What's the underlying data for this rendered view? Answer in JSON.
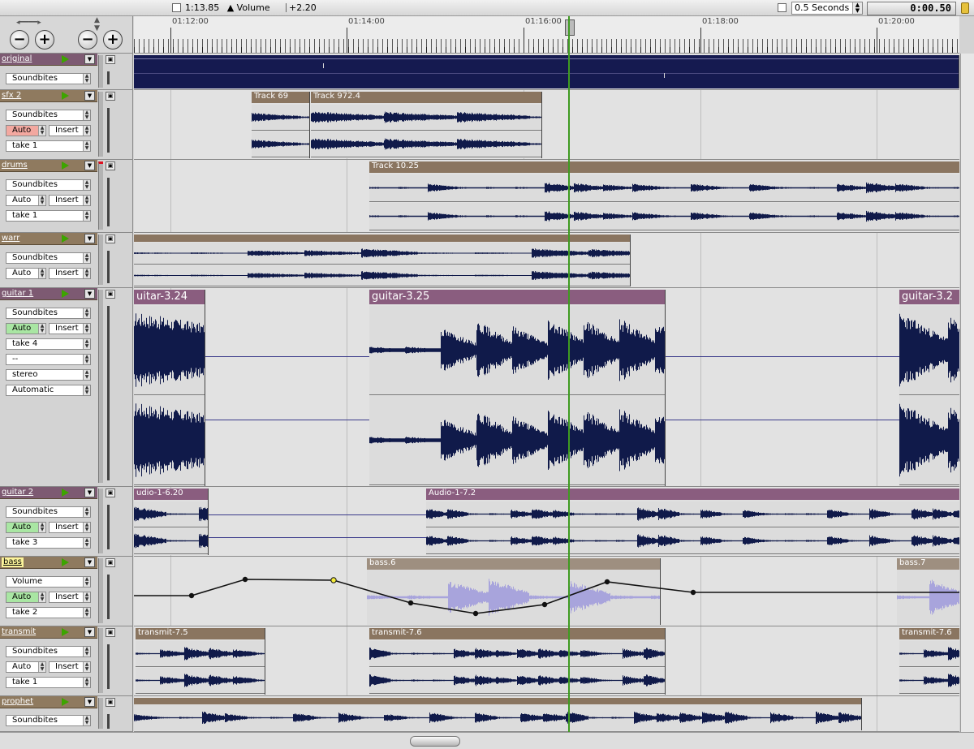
{
  "toolbar": {
    "position": "1:13.85",
    "param_label": "Volume",
    "param_value": "+2.20",
    "resolution": "0.5 Seconds",
    "counter": "0:00.50"
  },
  "ruler": {
    "labels": [
      "01:12:00",
      "01:14:00",
      "01:16:00",
      "01:18:00",
      "01:20:00"
    ]
  },
  "tracks": [
    {
      "name": "original",
      "fields": [
        "Soundbites"
      ]
    },
    {
      "name": "sfx 2",
      "fields": [
        "Soundbites",
        "Auto",
        "Insert",
        "take 1"
      ]
    },
    {
      "name": "drums",
      "fields": [
        "Soundbites",
        "Auto",
        "Insert",
        "take 1"
      ]
    },
    {
      "name": "warr",
      "fields": [
        "Soundbites",
        "Auto",
        "Insert"
      ]
    },
    {
      "name": "guitar 1",
      "fields": [
        "Soundbites",
        "Auto",
        "Insert",
        "take 4",
        "--",
        "stereo",
        "Automatic"
      ]
    },
    {
      "name": "guitar 2",
      "fields": [
        "Soundbites",
        "Auto",
        "Insert",
        "take 3"
      ]
    },
    {
      "name": "bass",
      "fields": [
        "Volume",
        "Auto",
        "Insert",
        "take 2"
      ]
    },
    {
      "name": "transmit",
      "fields": [
        "Soundbites",
        "Auto",
        "Insert",
        "take 1"
      ]
    },
    {
      "name": "prophet",
      "fields": [
        "Soundbites"
      ]
    }
  ],
  "clips": {
    "sfx_a": "Track 69",
    "sfx_b": "Track 972.4",
    "drums": "Track 10.25",
    "g1_a": "uitar-3.24",
    "g1_b": "guitar-3.25",
    "g1_c": "guitar-3.2",
    "g2_a": "udio-1-6.20",
    "g2_b": "Audio-1-7.2",
    "bass_a": "bass.6",
    "bass_b": "bass.7",
    "tr_a": "transmit-7.5",
    "tr_b": "transmit-7.6",
    "tr_c": "transmit-7.6"
  },
  "colors": {
    "wave": "#101a4a",
    "bass_wave": "#a8a4dc",
    "playhead": "#3f9b21",
    "clip_brown": "#8a7560",
    "clip_plum": "#8a5d7f",
    "auto_red": "#f3a8a0",
    "auto_green": "#a9e6a3"
  }
}
